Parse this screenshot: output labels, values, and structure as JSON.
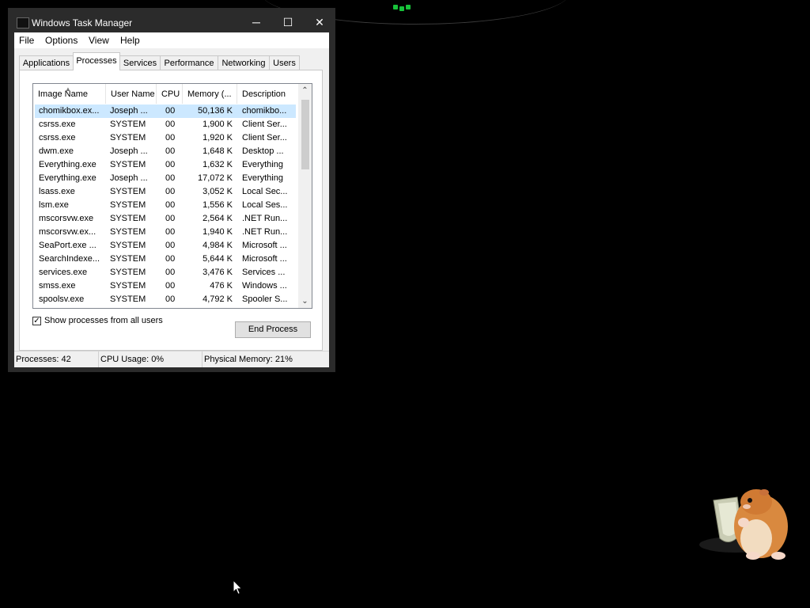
{
  "window": {
    "title": "Windows Task Manager",
    "minimize_glyph": "─",
    "maximize_glyph": "☐",
    "close_glyph": "✕"
  },
  "menu": [
    "File",
    "Options",
    "View",
    "Help"
  ],
  "tabs": [
    "Applications",
    "Processes",
    "Services",
    "Performance",
    "Networking",
    "Users"
  ],
  "active_tab": "Processes",
  "columns": [
    "Image Name",
    "User Name",
    "CPU",
    "Memory (...",
    "Description"
  ],
  "processes": [
    [
      "chomikbox.ex...",
      "Joseph ...",
      "00",
      "50,136 K",
      "chomikbo..."
    ],
    [
      "csrss.exe",
      "SYSTEM",
      "00",
      "1,900 K",
      "Client Ser..."
    ],
    [
      "csrss.exe",
      "SYSTEM",
      "00",
      "1,920 K",
      "Client Ser..."
    ],
    [
      "dwm.exe",
      "Joseph ...",
      "00",
      "1,648 K",
      "Desktop ..."
    ],
    [
      "Everything.exe",
      "SYSTEM",
      "00",
      "1,632 K",
      "Everything"
    ],
    [
      "Everything.exe",
      "Joseph ...",
      "00",
      "17,072 K",
      "Everything"
    ],
    [
      "lsass.exe",
      "SYSTEM",
      "00",
      "3,052 K",
      "Local Sec..."
    ],
    [
      "lsm.exe",
      "SYSTEM",
      "00",
      "1,556 K",
      "Local Ses..."
    ],
    [
      "mscorsvw.exe",
      "SYSTEM",
      "00",
      "2,564 K",
      ".NET Run..."
    ],
    [
      "mscorsvw.ex...",
      "SYSTEM",
      "00",
      "1,940 K",
      ".NET Run..."
    ],
    [
      "SeaPort.exe ...",
      "SYSTEM",
      "00",
      "4,984 K",
      "Microsoft ..."
    ],
    [
      "SearchIndexe...",
      "SYSTEM",
      "00",
      "5,644 K",
      "Microsoft ..."
    ],
    [
      "services.exe",
      "SYSTEM",
      "00",
      "3,476 K",
      "Services ..."
    ],
    [
      "smss.exe",
      "SYSTEM",
      "00",
      "476 K",
      "Windows ..."
    ],
    [
      "spoolsv.exe",
      "SYSTEM",
      "00",
      "4,792 K",
      "Spooler S..."
    ]
  ],
  "selected_row": 0,
  "show_all_label": "Show processes from all users",
  "show_all_checked": true,
  "check_glyph": "✓",
  "end_process_label": "End Process",
  "status": {
    "processes": "Processes: 42",
    "cpu": "CPU Usage: 0%",
    "memory": "Physical Memory: 21%"
  },
  "icons": [
    "app-icon",
    "sort-up-icon",
    "scroll-up-icon",
    "scroll-down-icon",
    "hamster-icon",
    "mouse-pointer-icon"
  ],
  "colors": {
    "desktop": "#000000",
    "selection": "#cce8ff",
    "titlebar": "#2b2b2b",
    "accent_light": "#18c23a"
  }
}
